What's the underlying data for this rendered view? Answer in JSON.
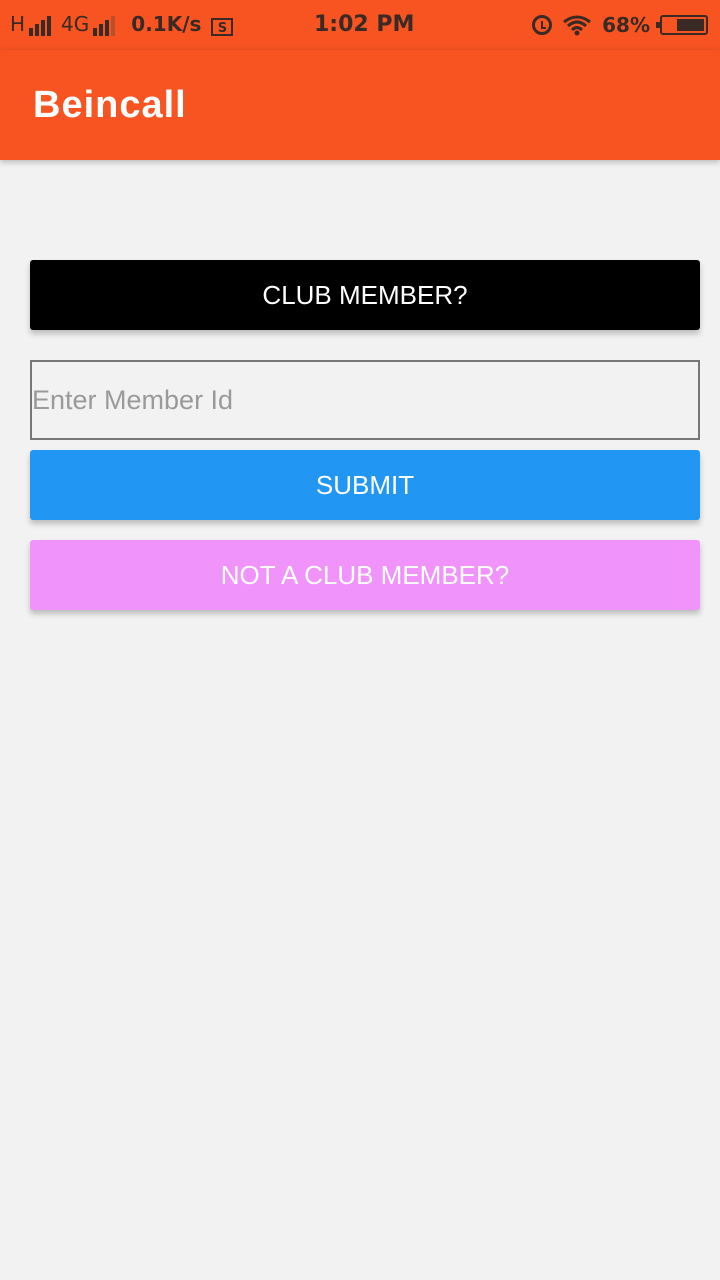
{
  "status_bar": {
    "network_type_1": "H",
    "network_type_2": "4G",
    "speed": "0.1K/s",
    "save_icon_letter": "S",
    "time": "1:02 PM",
    "battery_percent": "68%",
    "battery_level": 0.68
  },
  "app_bar": {
    "title": "Beincall",
    "color": "#f75421"
  },
  "form": {
    "club_member_label": "CLUB MEMBER?",
    "member_id_placeholder": "Enter Member Id",
    "member_id_value": "",
    "submit_label": "SUBMIT",
    "not_club_member_label": "NOT A CLUB MEMBER?"
  },
  "colors": {
    "club_button": "#000000",
    "submit_button": "#2196f3",
    "not_club_button": "#f093fb",
    "background": "#f2f2f2"
  }
}
